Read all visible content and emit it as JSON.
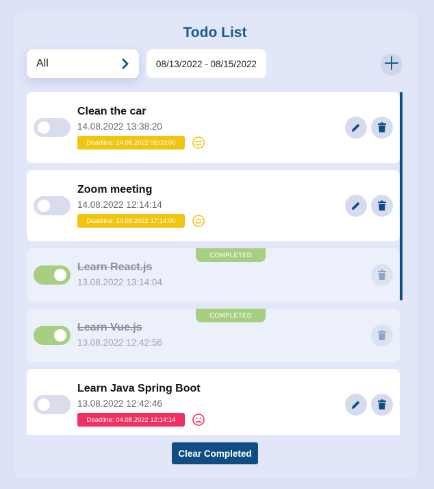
{
  "app": {
    "title": "Todo List",
    "filter": {
      "selected": "All"
    },
    "date_range": "08/13/2022 - 08/15/2022",
    "clear_button": "Clear Completed",
    "colors": {
      "primary": "#0f4d82",
      "completed": "#a7cf81",
      "deadline_warning": "#f1c40f",
      "deadline_overdue": "#f03060"
    }
  },
  "todos": [
    {
      "title": "Clean the car",
      "created": "14.08.2022 13:38:20",
      "completed": false,
      "deadline": "Deadline: 24.08.2022 05:03:00",
      "deadline_status": "warning",
      "mood_icon": "smiling-face-icon"
    },
    {
      "title": "Zoom meeting",
      "created": "14.08.2022 12:14:14",
      "completed": false,
      "deadline": "Deadline: 14.08.2022 17:14:00",
      "deadline_status": "warning",
      "mood_icon": "smiling-face-icon"
    },
    {
      "title": "Learn React.js",
      "created": "13.08.2022 13:14:04",
      "completed": true,
      "badge": "COMPLETED"
    },
    {
      "title": "Learn Vue.js",
      "created": "13.08.2022 12:42:56",
      "completed": true,
      "badge": "COMPLETED"
    },
    {
      "title": "Learn Java Spring Boot",
      "created": "13.08.2022 12:42:46",
      "completed": false,
      "deadline": "Deadline: 04.08.2022 12:14:14",
      "deadline_status": "overdue",
      "mood_icon": "sad-face-icon"
    }
  ]
}
